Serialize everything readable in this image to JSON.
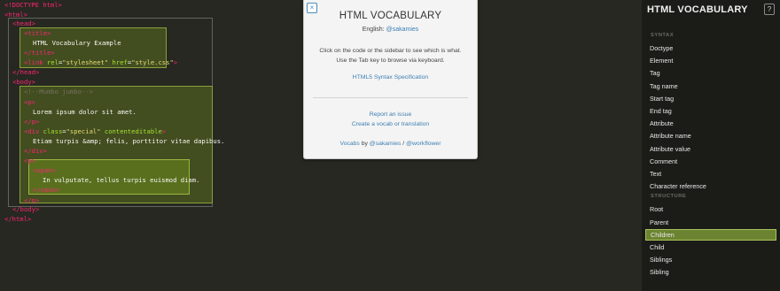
{
  "code": {
    "lines": [
      {
        "parts": [
          {
            "c": "doc",
            "t": "<!DOCTYPE html>"
          }
        ]
      },
      {
        "parts": [
          {
            "c": "tag",
            "t": "<html>"
          }
        ]
      },
      {
        "parts": [
          {
            "c": "tag",
            "t": "<head>"
          }
        ]
      },
      {
        "parts": [
          {
            "c": "tag",
            "t": "<title>"
          }
        ]
      },
      {
        "parts": [
          {
            "c": "txt",
            "t": "HTML Vocabulary Example"
          }
        ]
      },
      {
        "parts": [
          {
            "c": "tag",
            "t": "</title>"
          }
        ]
      },
      {
        "parts": [
          {
            "c": "tag",
            "t": "<link "
          },
          {
            "c": "attr",
            "t": "rel"
          },
          {
            "c": "txt",
            "t": "="
          },
          {
            "c": "str",
            "t": "\"stylesheet\""
          },
          {
            "c": "txt",
            "t": " "
          },
          {
            "c": "attr",
            "t": "href"
          },
          {
            "c": "txt",
            "t": "="
          },
          {
            "c": "str",
            "t": "\"style.css\""
          },
          {
            "c": "tag",
            "t": ">"
          }
        ]
      },
      {
        "parts": [
          {
            "c": "tag",
            "t": "</head>"
          }
        ]
      },
      {
        "parts": [
          {
            "c": "tag",
            "t": "<body>"
          }
        ]
      },
      {
        "parts": [
          {
            "c": "cmt",
            "t": "<!--Mumbo jumbo-->"
          }
        ]
      },
      {
        "parts": [
          {
            "c": "tag",
            "t": "<p>"
          }
        ]
      },
      {
        "parts": [
          {
            "c": "txt",
            "t": "Lorem ipsum dolor sit amet."
          }
        ]
      },
      {
        "parts": [
          {
            "c": "tag",
            "t": "</p>"
          }
        ]
      },
      {
        "parts": [
          {
            "c": "tag",
            "t": "<div "
          },
          {
            "c": "attr",
            "t": "class"
          },
          {
            "c": "txt",
            "t": "="
          },
          {
            "c": "str",
            "t": "\"special\""
          },
          {
            "c": "txt",
            "t": " "
          },
          {
            "c": "attr",
            "t": "contenteditable"
          },
          {
            "c": "tag",
            "t": ">"
          }
        ]
      },
      {
        "parts": [
          {
            "c": "txt",
            "t": "Etiam turpis &amp; felis, porttitor vitae dapibus."
          }
        ]
      },
      {
        "parts": [
          {
            "c": "tag",
            "t": "</div>"
          }
        ]
      },
      {
        "parts": [
          {
            "c": "tag",
            "t": "<p>"
          }
        ]
      },
      {
        "parts": [
          {
            "c": "tag",
            "t": "<span>"
          }
        ]
      },
      {
        "parts": [
          {
            "c": "txt",
            "t": "In vulputate, tellus turpis euismod diam."
          }
        ]
      },
      {
        "parts": [
          {
            "c": "tag",
            "t": "</span>"
          }
        ]
      },
      {
        "parts": [
          {
            "c": "tag",
            "t": "</p>"
          }
        ]
      },
      {
        "parts": [
          {
            "c": "tag",
            "t": "</body>"
          }
        ]
      },
      {
        "parts": [
          {
            "c": "tag",
            "t": "</html>"
          }
        ]
      }
    ]
  },
  "modal": {
    "close_label": "×",
    "title": "HTML VOCABULARY",
    "language_label": "English:",
    "language_author": "@sakamies",
    "instructions_line1": "Click on the code or the sidebar to see which is what.",
    "instructions_line2": "Use the Tab key to browse via keyboard.",
    "spec_link": "HTML5 Syntax Specification",
    "report_link": "Report an issue",
    "create_link": "Create a vocab or translation",
    "credits_prefix": "Vocabs",
    "credits_by": "by",
    "credits_author1": "@sakamies",
    "credits_sep": "/",
    "credits_author2": "@workflower"
  },
  "sidebar": {
    "title": "HTML VOCABULARY",
    "help_label": "?",
    "sections": [
      {
        "label": "SYNTAX",
        "items": [
          "Doctype",
          "Element",
          "Tag",
          "Tag name",
          "Start tag",
          "End tag",
          "Attribute",
          "Attribute name",
          "Attribute value",
          "Comment",
          "Text",
          "Character reference"
        ]
      },
      {
        "label": "STRUCTURE",
        "items": [
          "Root",
          "Parent",
          "Children",
          "Child",
          "Siblings",
          "Sibling"
        ]
      }
    ],
    "active_item": "Children"
  },
  "colors": {
    "background": "#272822",
    "sidebar_bg": "#1b1b18",
    "tag": "#f92672",
    "attribute": "#a6e22e",
    "string": "#e6db74",
    "comment": "#75715e",
    "highlight": "#6c8431",
    "link": "#3c7fb3"
  }
}
